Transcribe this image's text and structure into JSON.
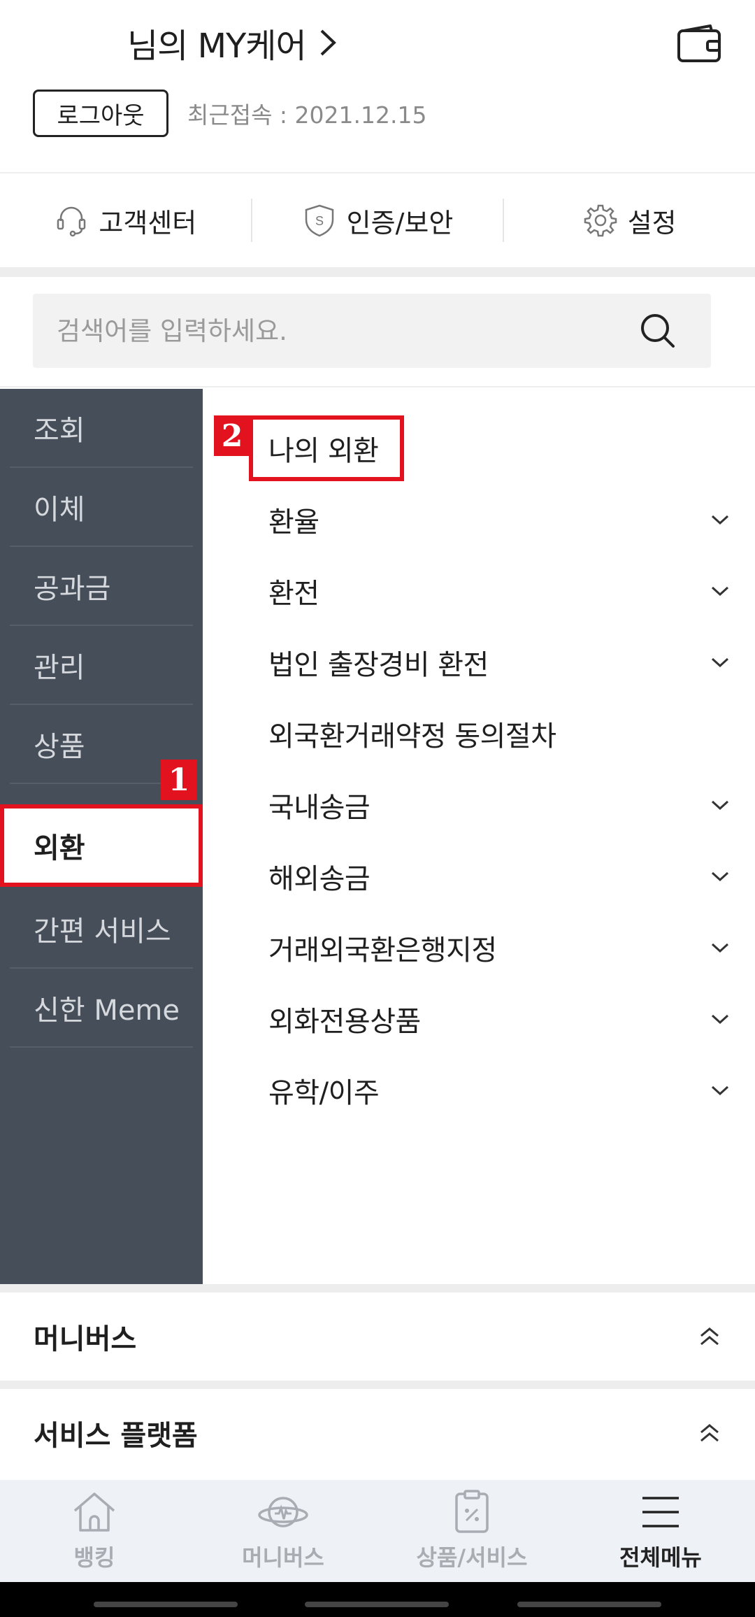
{
  "header": {
    "mycare_title": "님의 MY케어",
    "logout_label": "로그아웃",
    "last_login": "최근접속 : 2021.12.15"
  },
  "quick_links": [
    {
      "label": "고객센터",
      "icon": "headset-icon"
    },
    {
      "label": "인증/보안",
      "icon": "shield-icon"
    },
    {
      "label": "설정",
      "icon": "gear-icon"
    }
  ],
  "search": {
    "placeholder": "검색어를 입력하세요."
  },
  "sidebar": {
    "items": [
      {
        "label": "조회"
      },
      {
        "label": "이체"
      },
      {
        "label": "공과금"
      },
      {
        "label": "관리"
      },
      {
        "label": "상품"
      },
      {
        "label": "외환",
        "active": true
      },
      {
        "label": "간편 서비스"
      },
      {
        "label": "신한 Meme"
      }
    ]
  },
  "submenu": {
    "items": [
      {
        "label": "나의 외환",
        "expandable": false
      },
      {
        "label": "환율",
        "expandable": true
      },
      {
        "label": "환전",
        "expandable": true
      },
      {
        "label": "법인 출장경비 환전",
        "expandable": true
      },
      {
        "label": "외국환거래약정 동의절차",
        "expandable": false
      },
      {
        "label": "국내송금",
        "expandable": true
      },
      {
        "label": "해외송금",
        "expandable": true
      },
      {
        "label": "거래외국환은행지정",
        "expandable": true
      },
      {
        "label": "외화전용상품",
        "expandable": true
      },
      {
        "label": "유학/이주",
        "expandable": true
      }
    ]
  },
  "annotations": {
    "step1": "1",
    "step2": "2",
    "color": "#e2121f"
  },
  "accordions": [
    {
      "title": "머니버스"
    },
    {
      "title": "서비스 플랫폼"
    }
  ],
  "bottom_nav": {
    "items": [
      {
        "label": "뱅킹",
        "icon": "home-icon"
      },
      {
        "label": "머니버스",
        "icon": "planet-icon"
      },
      {
        "label": "상품/서비스",
        "icon": "coupon-icon"
      },
      {
        "label": "전체메뉴",
        "icon": "menu-icon",
        "active": true
      }
    ]
  }
}
